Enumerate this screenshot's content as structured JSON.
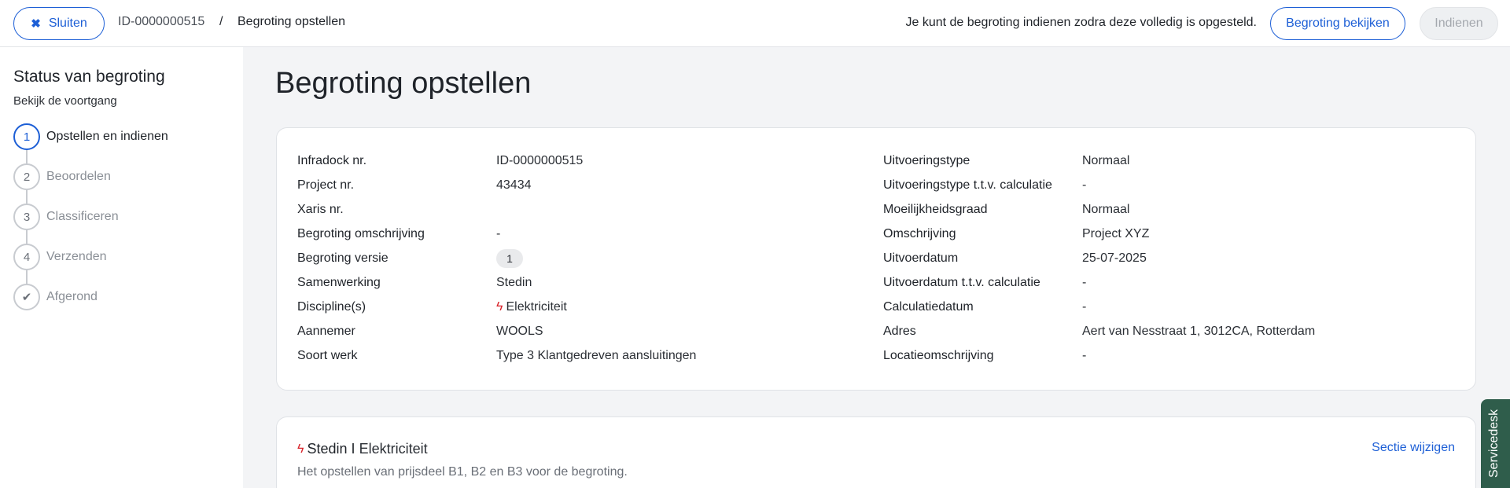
{
  "topbar": {
    "close_label": "Sluiten",
    "close_icon": "close-icon",
    "breadcrumb_id": "ID-0000000515",
    "breadcrumb_sep": "/",
    "breadcrumb_current": "Begroting opstellen",
    "info_text": "Je kunt de begroting indienen zodra deze volledig is opgesteld.",
    "view_label": "Begroting bekijken",
    "submit_label": "Indienen"
  },
  "sidebar": {
    "title": "Status van begroting",
    "subtitle": "Bekijk de voortgang",
    "steps": [
      {
        "marker": "1",
        "label": "Opstellen en indienen",
        "active": true
      },
      {
        "marker": "2",
        "label": "Beoordelen",
        "active": false
      },
      {
        "marker": "3",
        "label": "Classificeren",
        "active": false
      },
      {
        "marker": "4",
        "label": "Verzenden",
        "active": false
      },
      {
        "marker": "✔",
        "label": "Afgerond",
        "active": false
      }
    ]
  },
  "main": {
    "title": "Begroting opstellen",
    "details_left": [
      {
        "key": "Infradock nr.",
        "value": "ID-0000000515"
      },
      {
        "key": "Project nr.",
        "value": "43434"
      },
      {
        "key": "Xaris nr.",
        "value": ""
      },
      {
        "key": "Begroting omschrijving",
        "value": "-"
      },
      {
        "key": "Begroting versie",
        "value": "1"
      },
      {
        "key": "Samenwerking",
        "value": "Stedin"
      },
      {
        "key": "Discipline(s)",
        "value": "Elektriciteit"
      },
      {
        "key": "Aannemer",
        "value": "WOOLS"
      },
      {
        "key": "Soort werk",
        "value": "Type 3 Klantgedreven aansluitingen"
      }
    ],
    "details_right": [
      {
        "key": "Uitvoeringstype",
        "value": "Normaal"
      },
      {
        "key": "Uitvoeringstype t.t.v. calculatie",
        "value": "-"
      },
      {
        "key": "Moeilijkheidsgraad",
        "value": "Normaal"
      },
      {
        "key": "Omschrijving",
        "value": "Project XYZ"
      },
      {
        "key": "Uitvoerdatum",
        "value": "25-07-2025"
      },
      {
        "key": "Uitvoerdatum t.t.v. calculatie",
        "value": "-"
      },
      {
        "key": "Calculatiedatum",
        "value": "-"
      },
      {
        "key": "Adres",
        "value": "Aert van Nesstraat 1, 3012CA, Rotterdam"
      },
      {
        "key": "Locatieomschrijving",
        "value": "-"
      }
    ],
    "section": {
      "company": "Stedin",
      "separator": "I",
      "discipline": "Elektriciteit",
      "description": "Het opstellen van prijsdeel B1, B2 en B3 voor de begroting.",
      "edit_label": "Sectie wijzigen"
    }
  },
  "servicedesk_label": "Servicedesk",
  "colors": {
    "accent": "#1d5fd6",
    "electric": "#d8232a",
    "servicedesk": "#2f5d4b"
  }
}
